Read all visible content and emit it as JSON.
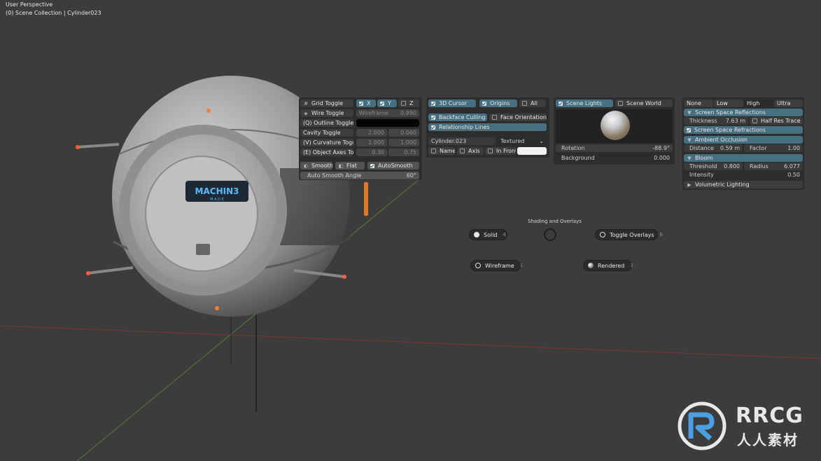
{
  "viewport": {
    "perspective": "User Perspective",
    "collection": "(0) Scene Collection | Cylinder023",
    "model_logo": "MACHIN3",
    "model_logo_sub": "M A D E"
  },
  "overlays_panel": {
    "grid_toggle": "Grid Toggle",
    "x": "X",
    "y": "Y",
    "z": "Z",
    "wire_toggle": "Wire Toggle",
    "wireframe": "Wireframe",
    "wireframe_val": "0.990",
    "outline_toggle": "(Q) Outline Toggle",
    "cavity_toggle": "Cavity Toggle",
    "cavity_a": "2.000",
    "cavity_b": "0.060",
    "curvature_toggle": "(V) Curvature Toggle",
    "curv_a": "1.000",
    "curv_b": "1.000",
    "object_axes": "(E) Object Axes Tog...",
    "axes_a": "0.30",
    "axes_b": "0.75",
    "smooth": "Smooth",
    "flat": "Flat",
    "autosmooth": "AutoSmooth",
    "autosmooth_angle_label": "Auto Smooth Angle",
    "autosmooth_angle": "60°"
  },
  "cursor_panel": {
    "cursor3d": "3D Cursor",
    "origins": "Origins",
    "all": "All",
    "backface": "Backface Culling",
    "face_orient": "Face Orientation",
    "relationship": "Relationship Lines",
    "object_name": "Cylinder.023",
    "display_mode": "Textured",
    "name": "Name",
    "axis": "Axis",
    "in_front": "In Front"
  },
  "lights_panel": {
    "scene_lights": "Scene Lights",
    "scene_world": "Scene World",
    "rotation_label": "Rotation",
    "rotation": "-88.9°",
    "background_label": "Background",
    "background": "0.000"
  },
  "eevee_panel": {
    "quality": [
      "None",
      "Low",
      "High",
      "Ultra"
    ],
    "ssr": "Screen Space Reflections",
    "thickness_label": "Thickness",
    "thickness": "7.63 m",
    "half_res": "Half Res Trace",
    "ssrefr": "Screen Space Refractions",
    "ao": "Ambient Occlusion",
    "distance_label": "Distance",
    "distance": "0.59 m",
    "factor_label": "Factor",
    "factor": "1.00",
    "bloom": "Bloom",
    "threshold_label": "Threshold",
    "threshold": "0.800",
    "radius_label": "Radius",
    "radius": "6.077",
    "intensity_label": "Intensity",
    "intensity": "0.50",
    "volumetric": "Volumetric Lighting"
  },
  "pie_menu": {
    "title": "Shading and Overlays",
    "solid": "Solid",
    "solid_key": "4",
    "toggle_overlays": "Toggle Overlays",
    "overlays_key": "6",
    "wireframe": "Wireframe",
    "wireframe_key": "1",
    "rendered": "Rendered",
    "rendered_key": "3"
  },
  "watermark": {
    "brand": "RRCG",
    "sub": "人人素材"
  },
  "colors": {
    "accent_teal": "#46707f",
    "accent_blue": "#4772b3",
    "panel": "#2d2d2d",
    "viewport": "#3c3c3c"
  }
}
